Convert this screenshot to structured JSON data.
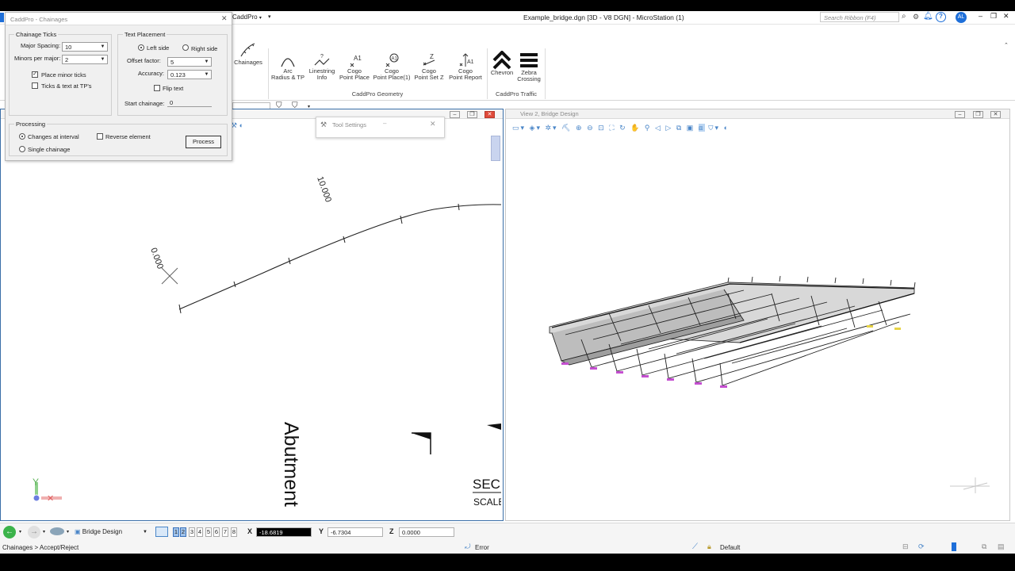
{
  "window": {
    "title": "Example_bridge.dgn [3D - V8 DGN] - MicroStation (1)",
    "workflow": "CaddPro",
    "search_placeholder": "Search Ribbon (F4)",
    "user_initials": "AL"
  },
  "ribbon": {
    "geometry_group_label": "CaddPro Geometry",
    "traffic_group_label": "CaddPro Traffic",
    "chainages_label": "Chainages",
    "buttons": [
      {
        "line1": "Arc",
        "line2": "Radius & TP"
      },
      {
        "line1": "Linestring",
        "line2": "Info"
      },
      {
        "line1": "Cogo",
        "line2": "Point Place"
      },
      {
        "line1": "Cogo",
        "line2": "Point Place(1)"
      },
      {
        "line1": "Cogo",
        "line2": "Point Set Z"
      },
      {
        "line1": "Cogo",
        "line2": "Point Report"
      }
    ],
    "traffic_buttons": [
      {
        "line1": "Chevron",
        "line2": ""
      },
      {
        "line1": "Zebra",
        "line2": "Crossing"
      }
    ]
  },
  "dialog": {
    "title": "CaddPro - Chainages",
    "chainage_ticks": {
      "legend": "Chainage Ticks",
      "major_spacing_label": "Major Spacing:",
      "major_spacing_value": "10",
      "minors_label": "Minors per major:",
      "minors_value": "2",
      "place_minor_ticks_label": "Place minor ticks",
      "place_minor_ticks_checked": true,
      "ticks_text_tp_label": "Ticks & text at TP's",
      "ticks_text_tp_checked": false
    },
    "text_placement": {
      "legend": "Text Placement",
      "left_side_label": "Left side",
      "right_side_label": "Right side",
      "selected_side": "left",
      "offset_factor_label": "Offset factor:",
      "offset_factor_value": "5",
      "accuracy_label": "Accuracy:",
      "accuracy_value": "0.123",
      "flip_text_label": "Flip text",
      "flip_text_checked": false,
      "start_chainage_label": "Start chainage:",
      "start_chainage_value": "0"
    },
    "processing": {
      "legend": "Processing",
      "changes_at_interval_label": "Changes at interval",
      "single_chainage_label": "Single chainage",
      "selected_mode": "interval",
      "reverse_element_label": "Reverse element",
      "reverse_element_checked": false,
      "process_button": "Process"
    }
  },
  "tool_settings": {
    "title": "Tool Settings"
  },
  "view1": {
    "chainage_label_start": "0.000",
    "chainage_label_mid": "10.000",
    "abutment_text": "Abutment",
    "section_text": "SEC",
    "scale_text": "SCALE",
    "axis_y": "Y"
  },
  "view2": {
    "title": "View 2, Bridge Design"
  },
  "statusbar": {
    "model": "Bridge Design",
    "view_numbers": [
      "1",
      "2",
      "3",
      "4",
      "5",
      "6",
      "7",
      "8"
    ],
    "active_views": [
      "1",
      "2"
    ],
    "x_label": "X",
    "x_value": "-18.6819",
    "y_label": "Y",
    "y_value": "-6.7304",
    "z_label": "Z",
    "z_value": "0.0000",
    "prompt": "Chainages > Accept/Reject",
    "message": "Error",
    "level": "Default"
  },
  "colors": {
    "accent_blue": "#1e6fd9",
    "close_red": "#e04a3a",
    "active_x_field": "#000000"
  }
}
